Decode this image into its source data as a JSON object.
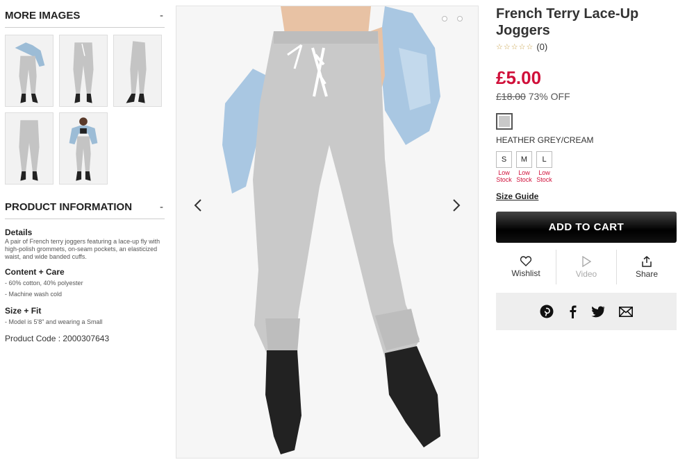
{
  "more_images": {
    "heading": "MORE IMAGES",
    "toggle": "-",
    "count": 5
  },
  "product_info": {
    "heading": "PRODUCT INFORMATION",
    "toggle": "-",
    "details_title": "Details",
    "details_text": "A pair of French terry joggers featuring a lace-up fly with high-polish grommets, on-seam pockets, an elasticized waist, and wide banded cuffs.",
    "content_title": "Content + Care",
    "content_lines": [
      "- 60% cotton, 40% polyester",
      "- Machine wash cold"
    ],
    "size_title": "Size + Fit",
    "size_lines": [
      "- Model is 5'8\" and wearing a Small"
    ],
    "product_code": "Product Code : 2000307643"
  },
  "product": {
    "title": "French Terry Lace-Up Joggers",
    "stars": "☆☆☆☆☆",
    "review_count": "(0)",
    "price": "£5.00",
    "original_price": "£18.00",
    "discount": "73% OFF",
    "color_name": "HEATHER GREY/CREAM",
    "sizes": [
      {
        "label": "S",
        "stock": "Low Stock"
      },
      {
        "label": "M",
        "stock": "Low Stock"
      },
      {
        "label": "L",
        "stock": "Low Stock"
      }
    ],
    "size_guide": "Size Guide",
    "add_to_cart": "ADD TO CART"
  },
  "actions": {
    "wishlist": "Wishlist",
    "video": "Video",
    "share": "Share"
  },
  "gallery": {
    "prev_icon": "chevron-left",
    "next_icon": "chevron-right"
  },
  "colors": {
    "price": "#d0103a",
    "swatch": "#c9c9c9"
  }
}
